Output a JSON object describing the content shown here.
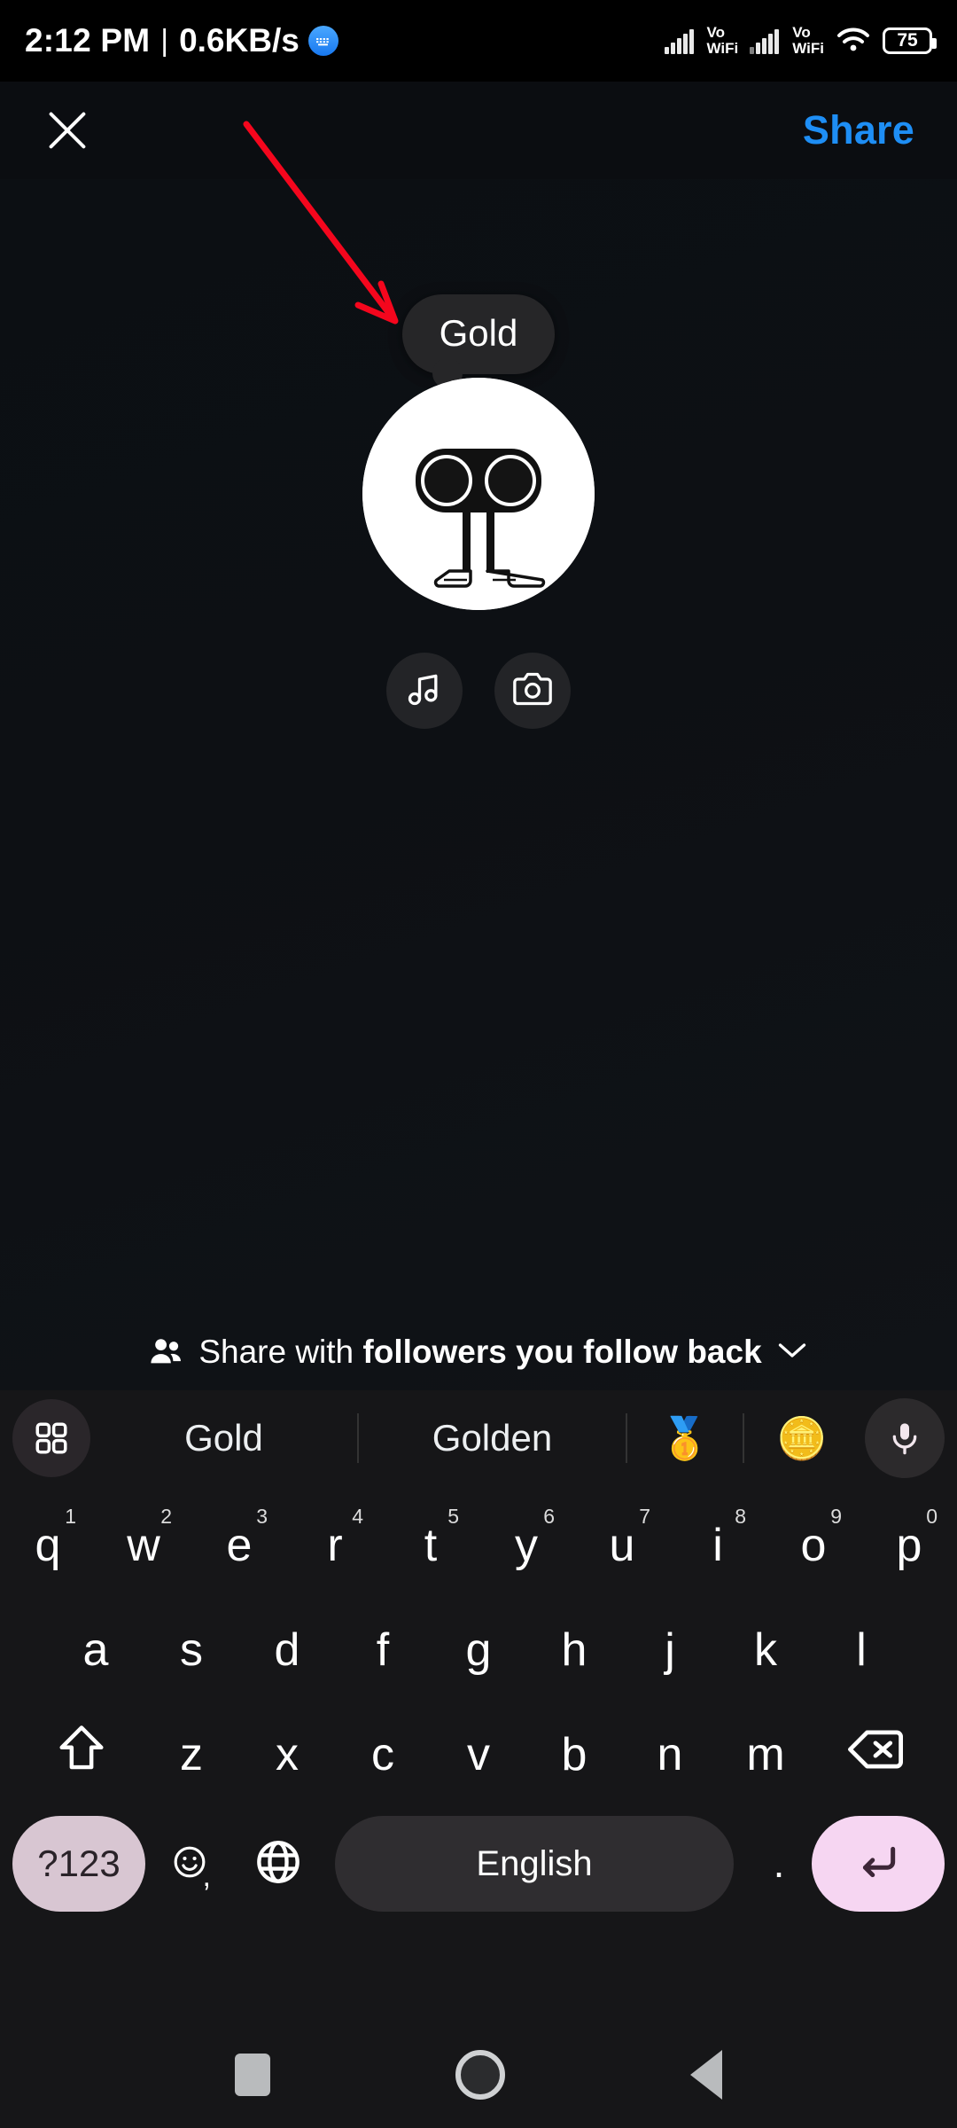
{
  "status_bar": {
    "time": "2:12 PM",
    "separator": "|",
    "network_speed": "0.6KB/s",
    "keyboard_badge_icon": "keyboard-badge-icon",
    "sim1_label": "Vo\nWiFi",
    "sim1_line1": "Vo",
    "sim1_line2": "WiFi",
    "sim2_line1": "Vo",
    "sim2_line2": "WiFi",
    "wifi_icon": "wifi-icon",
    "battery_level": "75"
  },
  "top_bar": {
    "close_icon": "close-icon",
    "share_label": "Share"
  },
  "note_composer": {
    "note_text": "Gold",
    "avatar_icon": "avatar-image",
    "music_icon": "music-note-icon",
    "camera_icon": "camera-icon"
  },
  "audience": {
    "people_icon": "people-icon",
    "prefix": "Share with ",
    "emphasis": "followers you follow back",
    "chevron_icon": "chevron-down-icon"
  },
  "annotation": {
    "arrow_color": "#f5061d",
    "arrow_icon": "red-pointer-arrow"
  },
  "keyboard": {
    "suggestion_bar": {
      "grid_icon": "grid-squares-icon",
      "suggestions": [
        "Gold",
        "Golden"
      ],
      "emoji_suggestions": [
        "🥇",
        "🪙"
      ],
      "mic_icon": "microphone-icon"
    },
    "row1": [
      {
        "letter": "q",
        "num": "1"
      },
      {
        "letter": "w",
        "num": "2"
      },
      {
        "letter": "e",
        "num": "3"
      },
      {
        "letter": "r",
        "num": "4"
      },
      {
        "letter": "t",
        "num": "5"
      },
      {
        "letter": "y",
        "num": "6"
      },
      {
        "letter": "u",
        "num": "7"
      },
      {
        "letter": "i",
        "num": "8"
      },
      {
        "letter": "o",
        "num": "9"
      },
      {
        "letter": "p",
        "num": "0"
      }
    ],
    "row2": [
      "a",
      "s",
      "d",
      "f",
      "g",
      "h",
      "j",
      "k",
      "l"
    ],
    "row3": {
      "shift_icon": "shift-arrow-icon",
      "letters": [
        "z",
        "x",
        "c",
        "v",
        "b",
        "n",
        "m"
      ],
      "backspace_icon": "backspace-icon"
    },
    "row4": {
      "symbols_label": "?123",
      "emoji_icon": "emoji-smiley-icon",
      "comma": ",",
      "globe_icon": "globe-language-icon",
      "space_label": "English",
      "period": ".",
      "enter_icon": "enter-return-icon"
    },
    "colors": {
      "accent_key": "#d8c6d2",
      "enter_key": "#f6d6f2",
      "space_key": "#2f2d30",
      "background": "#161618"
    }
  },
  "nav_bar": {
    "recents_icon": "recents-square-icon",
    "home_icon": "home-circle-icon",
    "back_icon": "back-triangle-icon"
  },
  "theme": {
    "share_blue": "#1e8ef5",
    "canvas_bg": "#0d1014",
    "bubble_bg": "#262628"
  }
}
